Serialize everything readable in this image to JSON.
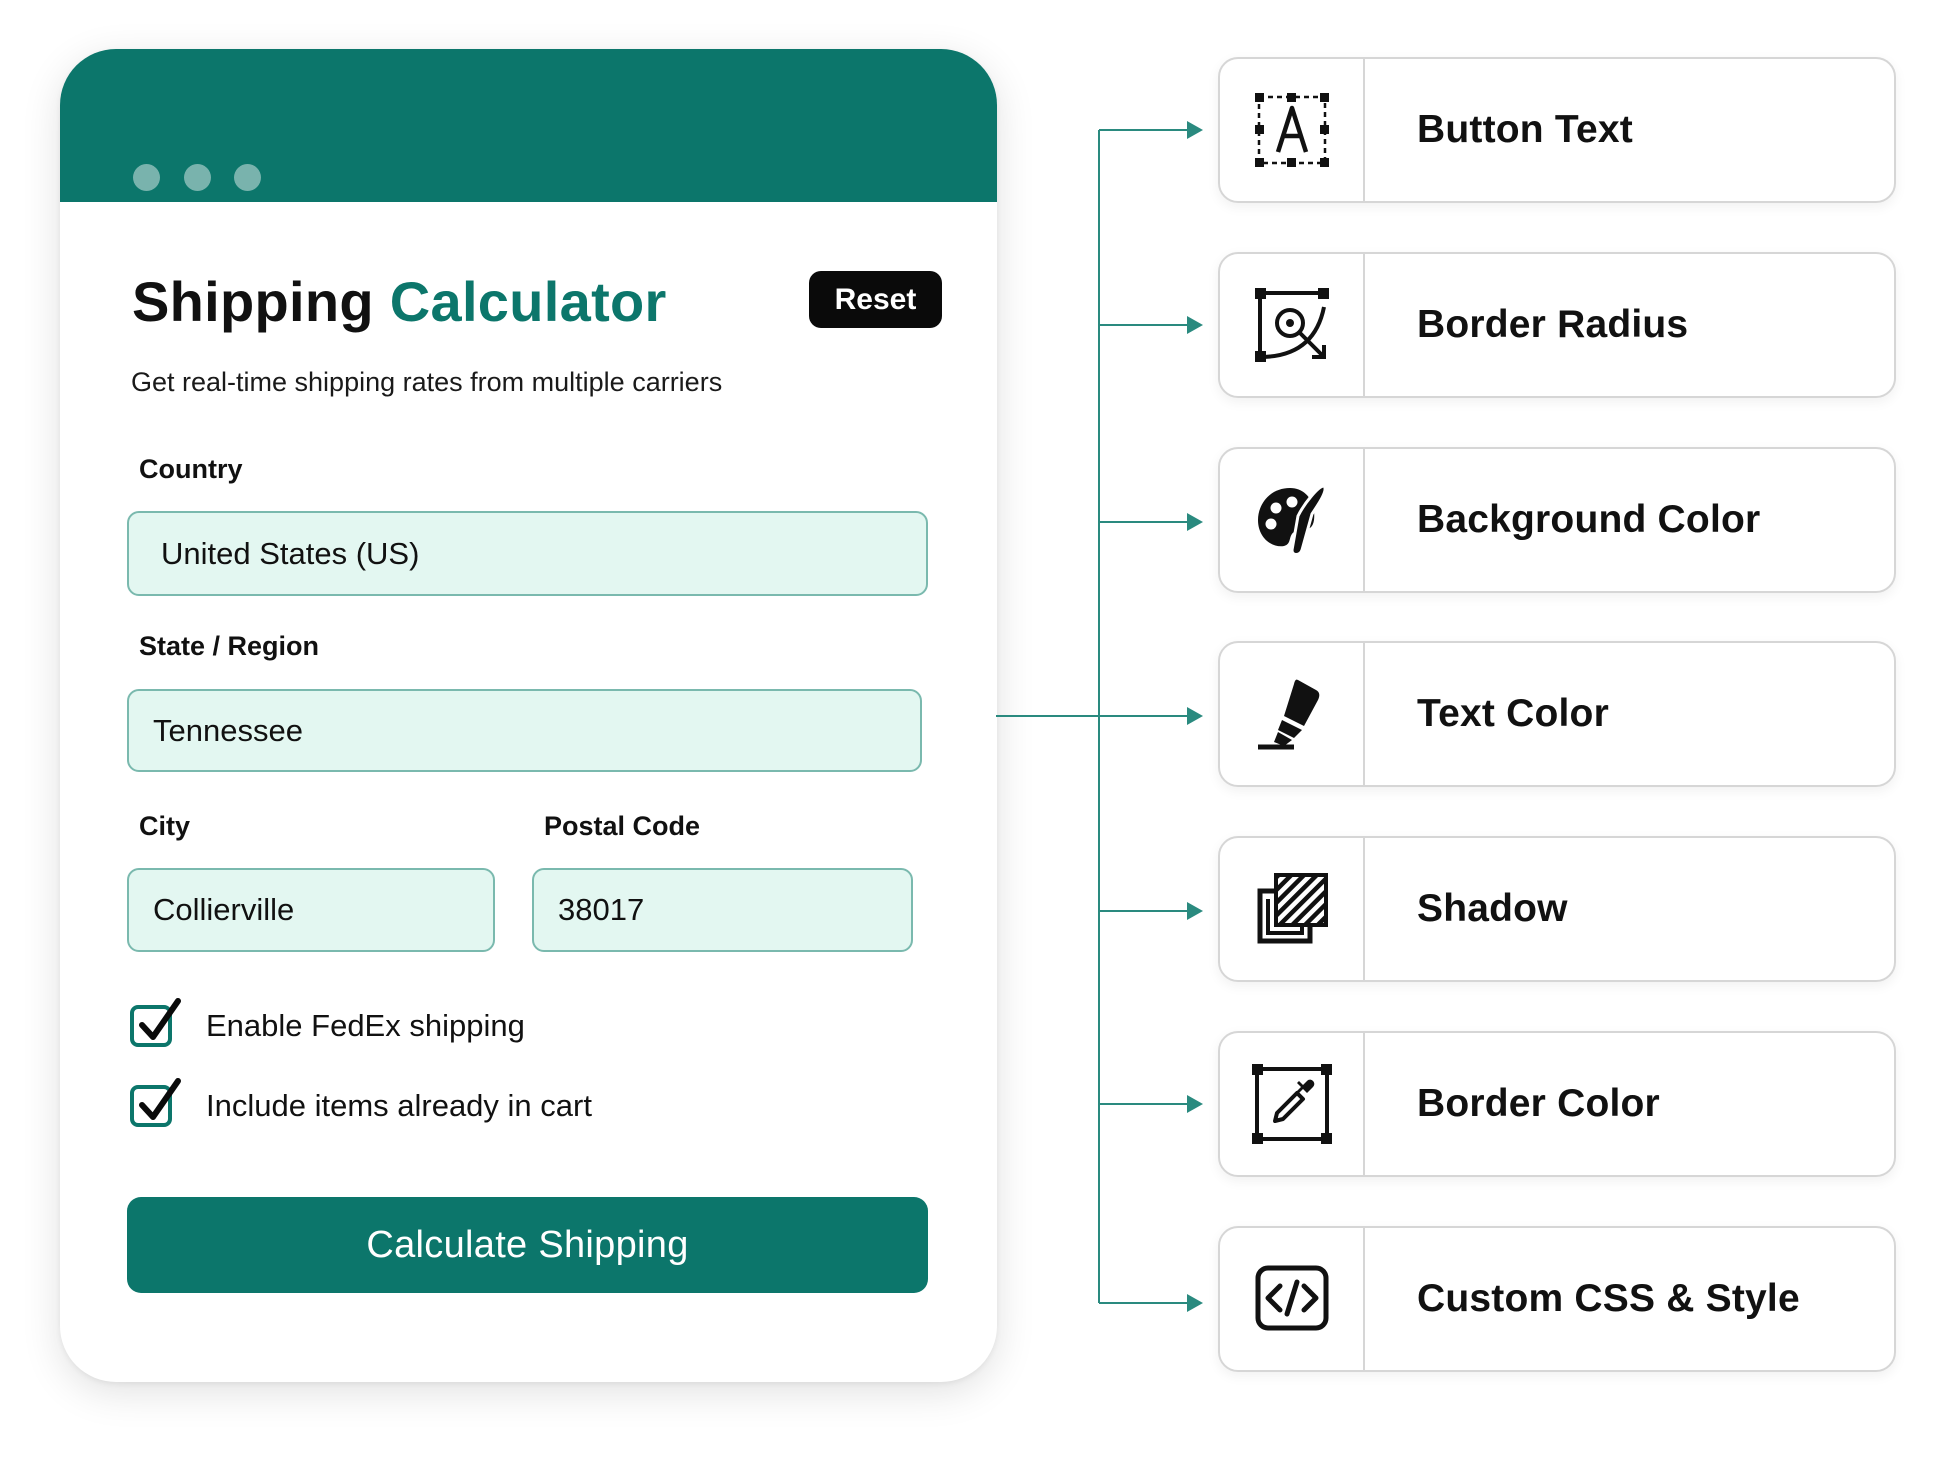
{
  "colors": {
    "accent": "#0c766b",
    "input_bg": "#e3f7f1",
    "input_border": "#7ab9ae",
    "dark": "#0a0a0a"
  },
  "window": {
    "title_main": "Shipping",
    "title_accent": "Calculator",
    "reset_label": "Reset",
    "subtitle": "Get real-time shipping rates from multiple carriers",
    "fields": {
      "country": {
        "label": "Country",
        "value": "United States (US)"
      },
      "state": {
        "label": "State / Region",
        "value": "Tennessee"
      },
      "city": {
        "label": "City",
        "value": "Collierville"
      },
      "postal": {
        "label": "Postal Code",
        "value": "38017"
      }
    },
    "checks": [
      {
        "label": "Enable FedEx shipping",
        "checked": true
      },
      {
        "label": "Include items already in cart",
        "checked": true
      }
    ],
    "calculate_label": "Calculate Shipping"
  },
  "features": [
    {
      "label": "Button Text",
      "icon": "text-select-icon"
    },
    {
      "label": "Border Radius",
      "icon": "border-radius-icon"
    },
    {
      "label": "Background Color",
      "icon": "palette-icon"
    },
    {
      "label": "Text Color",
      "icon": "marker-icon"
    },
    {
      "label": "Shadow",
      "icon": "shadow-icon"
    },
    {
      "label": "Border Color",
      "icon": "color-picker-icon"
    },
    {
      "label": "Custom CSS & Style",
      "icon": "code-icon"
    }
  ]
}
